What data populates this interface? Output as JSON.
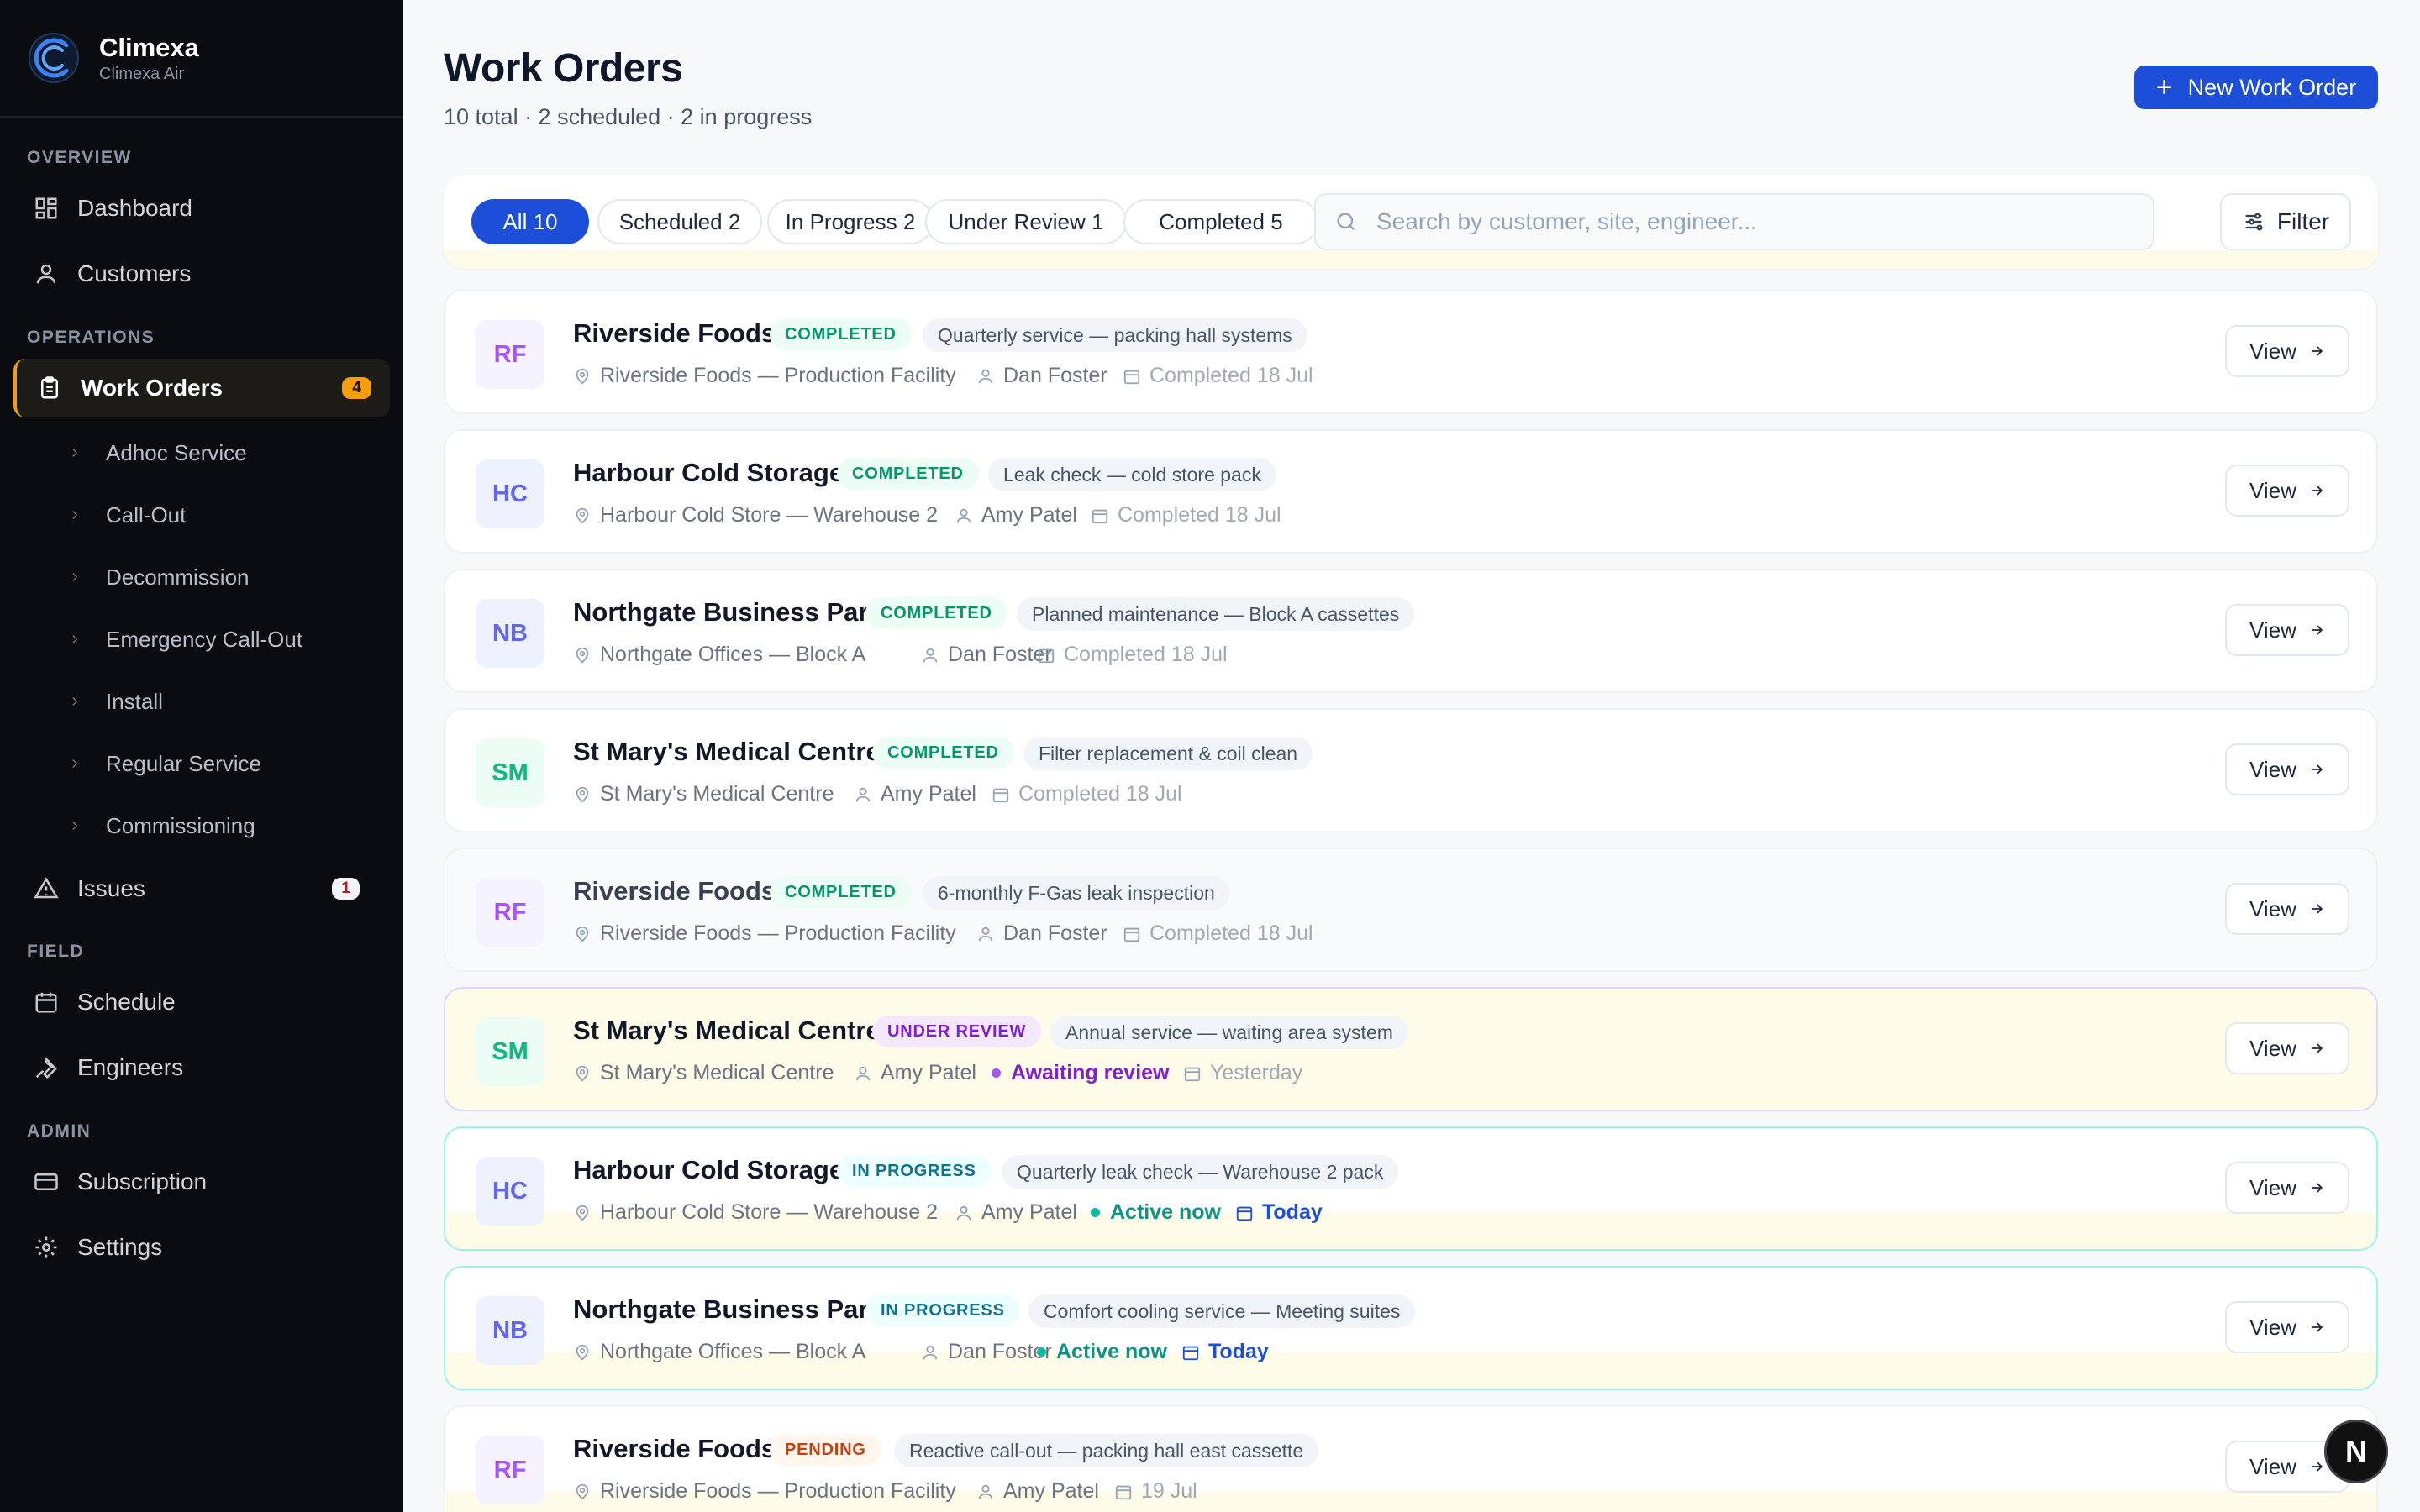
{
  "brand": {
    "name": "Climexa",
    "subtitle": "Climexa Air"
  },
  "nav": {
    "overview_label": "OVERVIEW",
    "dashboard": "Dashboard",
    "customers": "Customers",
    "operations_label": "OPERATIONS",
    "work_orders": "Work Orders",
    "work_orders_badge": "4",
    "sub_items": [
      "Adhoc Service",
      "Call-Out",
      "Decommission",
      "Emergency Call-Out",
      "Install",
      "Regular Service",
      "Commissioning"
    ],
    "issues": "Issues",
    "issues_badge": "1",
    "field_label": "FIELD",
    "schedule": "Schedule",
    "engineers": "Engineers",
    "admin_label": "ADMIN",
    "subscription": "Subscription",
    "settings": "Settings"
  },
  "header": {
    "title": "Work Orders",
    "summary": "10 total · 2 scheduled · 2 in progress",
    "new_button": "New Work Order"
  },
  "filters": {
    "tabs": [
      "All 10",
      "Scheduled 2",
      "In Progress 2",
      "Under Review 1",
      "Completed 5"
    ],
    "search_placeholder": "Search by customer, site, engineer...",
    "filter_button": "Filter"
  },
  "orders": [
    {
      "initials": "RF",
      "customer": "Riverside Foods",
      "status": "COMPLETED",
      "description": "Quarterly service — packing hall systems",
      "site": "Riverside Foods — Production Facility",
      "engineer": "Dan Foster",
      "date": "Completed 18 Jul"
    },
    {
      "initials": "HC",
      "customer": "Harbour Cold Storage",
      "status": "COMPLETED",
      "description": "Leak check — cold store pack",
      "site": "Harbour Cold Store — Warehouse 2",
      "engineer": "Amy Patel",
      "date": "Completed 18 Jul"
    },
    {
      "initials": "NB",
      "customer": "Northgate Business Park",
      "status": "COMPLETED",
      "description": "Planned maintenance — Block A cassettes",
      "site": "Northgate Offices — Block A",
      "engineer": "Dan Foster",
      "date": "Completed 18 Jul"
    },
    {
      "initials": "SM",
      "customer": "St Mary's Medical Centre",
      "status": "COMPLETED",
      "description": "Filter replacement & coil clean",
      "site": "St Mary's Medical Centre",
      "engineer": "Amy Patel",
      "date": "Completed 18 Jul"
    },
    {
      "initials": "RF",
      "customer": "Riverside Foods",
      "status": "COMPLETED",
      "description": "6-monthly F-Gas leak inspection",
      "site": "Riverside Foods — Production Facility",
      "engineer": "Dan Foster",
      "date": "Completed 18 Jul"
    },
    {
      "initials": "SM",
      "customer": "St Mary's Medical Centre",
      "status": "UNDER REVIEW",
      "description": "Annual service — waiting area system",
      "site": "St Mary's Medical Centre",
      "engineer": "Amy Patel",
      "live": "Awaiting review",
      "date": "Yesterday"
    },
    {
      "initials": "HC",
      "customer": "Harbour Cold Storage",
      "status": "IN PROGRESS",
      "description": "Quarterly leak check — Warehouse 2 pack",
      "site": "Harbour Cold Store — Warehouse 2",
      "engineer": "Amy Patel",
      "live": "Active now",
      "date": "Today"
    },
    {
      "initials": "NB",
      "customer": "Northgate Business Park",
      "status": "IN PROGRESS",
      "description": "Comfort cooling service — Meeting suites",
      "site": "Northgate Offices — Block A",
      "engineer": "Dan Foster",
      "live": "Active now",
      "date": "Today"
    },
    {
      "initials": "RF",
      "customer": "Riverside Foods",
      "status": "PENDING",
      "description": "Reactive call-out — packing hall east cassette",
      "site": "Riverside Foods — Production Facility",
      "engineer": "Amy Patel",
      "date": "19 Jul"
    }
  ],
  "view_label": "View",
  "fab_label": "N",
  "colors": {
    "accent": "#1d4ed8",
    "active_nav": "#f59e0b",
    "completed": "#059669",
    "review": "#7e22ce",
    "in_progress": "#0e7490",
    "pending": "#c2410c"
  }
}
